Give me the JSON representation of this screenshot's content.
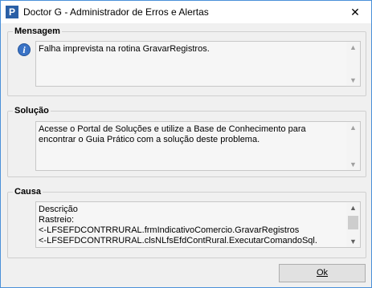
{
  "window": {
    "title": "Doctor G - Administrador de Erros e Alertas",
    "app_icon_letter": "P",
    "close_glyph": "✕"
  },
  "mensagem": {
    "label": "Mensagem",
    "text": "Falha imprevista na rotina GravarRegistros."
  },
  "solucao": {
    "label": "Solução",
    "text": "Acesse o Portal de Soluções e utilize a Base de Conhecimento para encontrar o Guia Prático com a solução deste problema."
  },
  "causa": {
    "label": "Causa",
    "lines": [
      "Descrição",
      "Rastreio:",
      "<-LFSEFDCONTRRURAL.frmIndicativoComercio.GravarRegistros",
      "<-LFSEFDCONTRRURAL.clsNLfsEfdContRural.ExecutarComandoSql."
    ]
  },
  "buttons": {
    "ok_label": "Ok"
  },
  "icons": {
    "info": "info-icon",
    "scroll_up": "▲",
    "scroll_down": "▼"
  }
}
